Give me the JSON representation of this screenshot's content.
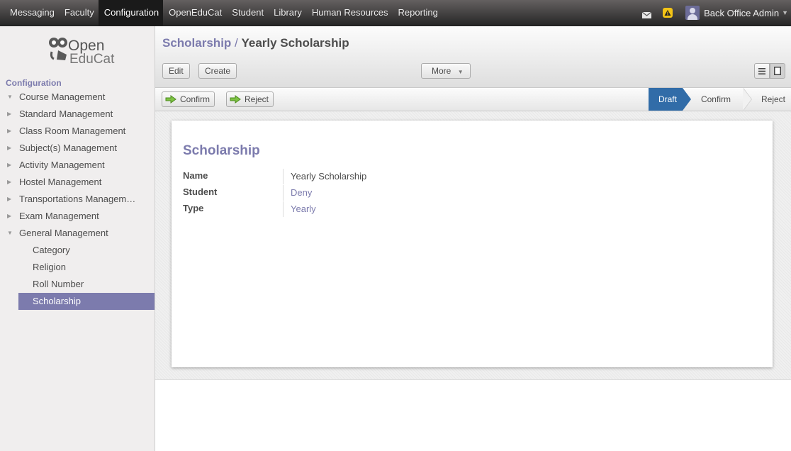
{
  "topbar": {
    "menu": [
      "Messaging",
      "Faculty",
      "Configuration",
      "OpenEduCat",
      "Student",
      "Library",
      "Human Resources",
      "Reporting"
    ],
    "active_menu": "Configuration",
    "user_name": "Back Office Admin"
  },
  "sidebar": {
    "logo": {
      "line1": "Open",
      "line2": "EduCat"
    },
    "section_title": "Configuration",
    "items": [
      {
        "label": "Course Management"
      },
      {
        "label": "Standard Management"
      },
      {
        "label": "Class Room Management"
      },
      {
        "label": "Subject(s) Management"
      },
      {
        "label": "Activity Management"
      },
      {
        "label": "Hostel Management"
      },
      {
        "label": "Transportations Managem…"
      },
      {
        "label": "Exam Management"
      },
      {
        "label": "General Management"
      }
    ],
    "subitems": [
      {
        "label": "Category"
      },
      {
        "label": "Religion"
      },
      {
        "label": "Roll Number"
      },
      {
        "label": "Scholarship"
      }
    ],
    "selected": "Scholarship"
  },
  "header": {
    "breadcrumb_parent": "Scholarship",
    "breadcrumb_separator": " / ",
    "breadcrumb_current": "Yearly Scholarship",
    "edit_label": "Edit",
    "create_label": "Create",
    "more_label": "More"
  },
  "statusbar": {
    "confirm_label": "Confirm",
    "reject_label": "Reject",
    "stages": [
      "Draft",
      "Confirm",
      "Reject"
    ],
    "active_stage": "Draft"
  },
  "form": {
    "title": "Scholarship",
    "fields": [
      {
        "label": "Name",
        "value": "Yearly Scholarship"
      },
      {
        "label": "Student",
        "value": "Deny"
      },
      {
        "label": "Type",
        "value": "Yearly"
      }
    ]
  },
  "colors": {
    "accent": "#7c7bad",
    "stage_active": "#316ca8"
  },
  "icons": [
    "mail-icon",
    "alert-icon",
    "avatar",
    "list-view-icon",
    "form-view-icon",
    "green-arrow-icon"
  ]
}
